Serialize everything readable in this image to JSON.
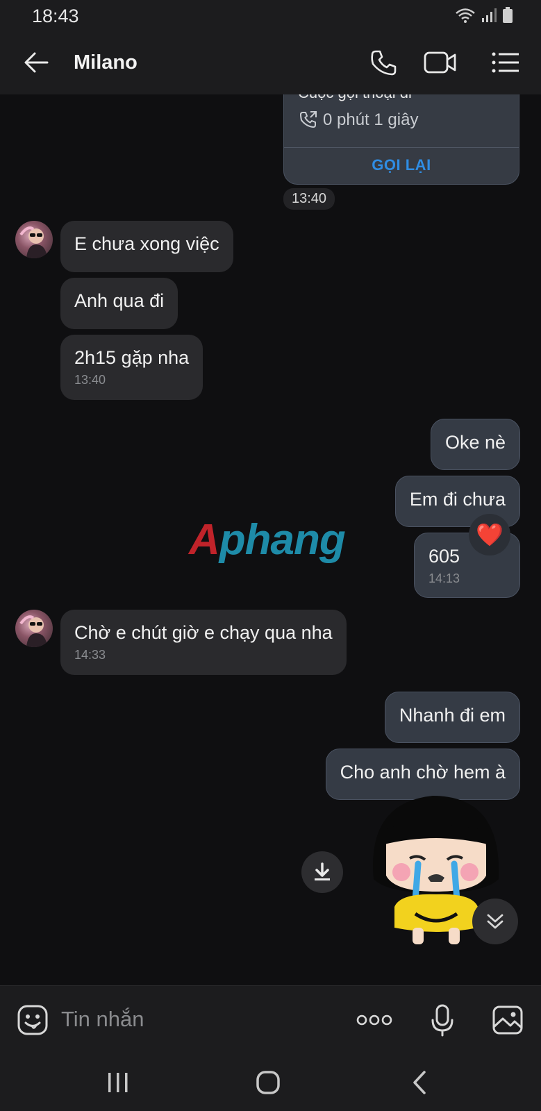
{
  "status_bar": {
    "time": "18:43"
  },
  "header": {
    "title": "Milano"
  },
  "call_card": {
    "title": "Cuộc gọi thoại đi",
    "duration": "0 phút 1 giây",
    "action": "GỌI LẠI",
    "time": "13:40"
  },
  "messages": [
    {
      "side": "in",
      "text": "E chưa xong việc"
    },
    {
      "side": "in",
      "text": "Anh qua đi"
    },
    {
      "side": "in",
      "text": "2h15 gặp nha",
      "time": "13:40"
    },
    {
      "side": "out",
      "text": "Oke nè"
    },
    {
      "side": "out",
      "text": "Em đi chưa",
      "reaction": "❤️"
    },
    {
      "side": "out",
      "text": "605",
      "time": "14:13"
    },
    {
      "side": "in",
      "text": "Chờ e chút giờ e chạy qua nha",
      "time": "14:33"
    },
    {
      "side": "out",
      "text": "Nhanh đi em"
    },
    {
      "side": "out",
      "text": "Cho anh chờ hem à"
    }
  ],
  "watermark": {
    "first": "A",
    "rest": "phang"
  },
  "input": {
    "placeholder": "Tin nhắn"
  },
  "colors": {
    "accent": "#2f8de4",
    "outgoing_bubble": "#353b45",
    "incoming_bubble": "#2a2a2d"
  },
  "icons": [
    "back-arrow-icon",
    "phone-icon",
    "video-icon",
    "menu-list-icon",
    "emoji-icon",
    "more-dots-icon",
    "microphone-icon",
    "gallery-icon",
    "download-icon",
    "chevron-double-down-icon"
  ]
}
